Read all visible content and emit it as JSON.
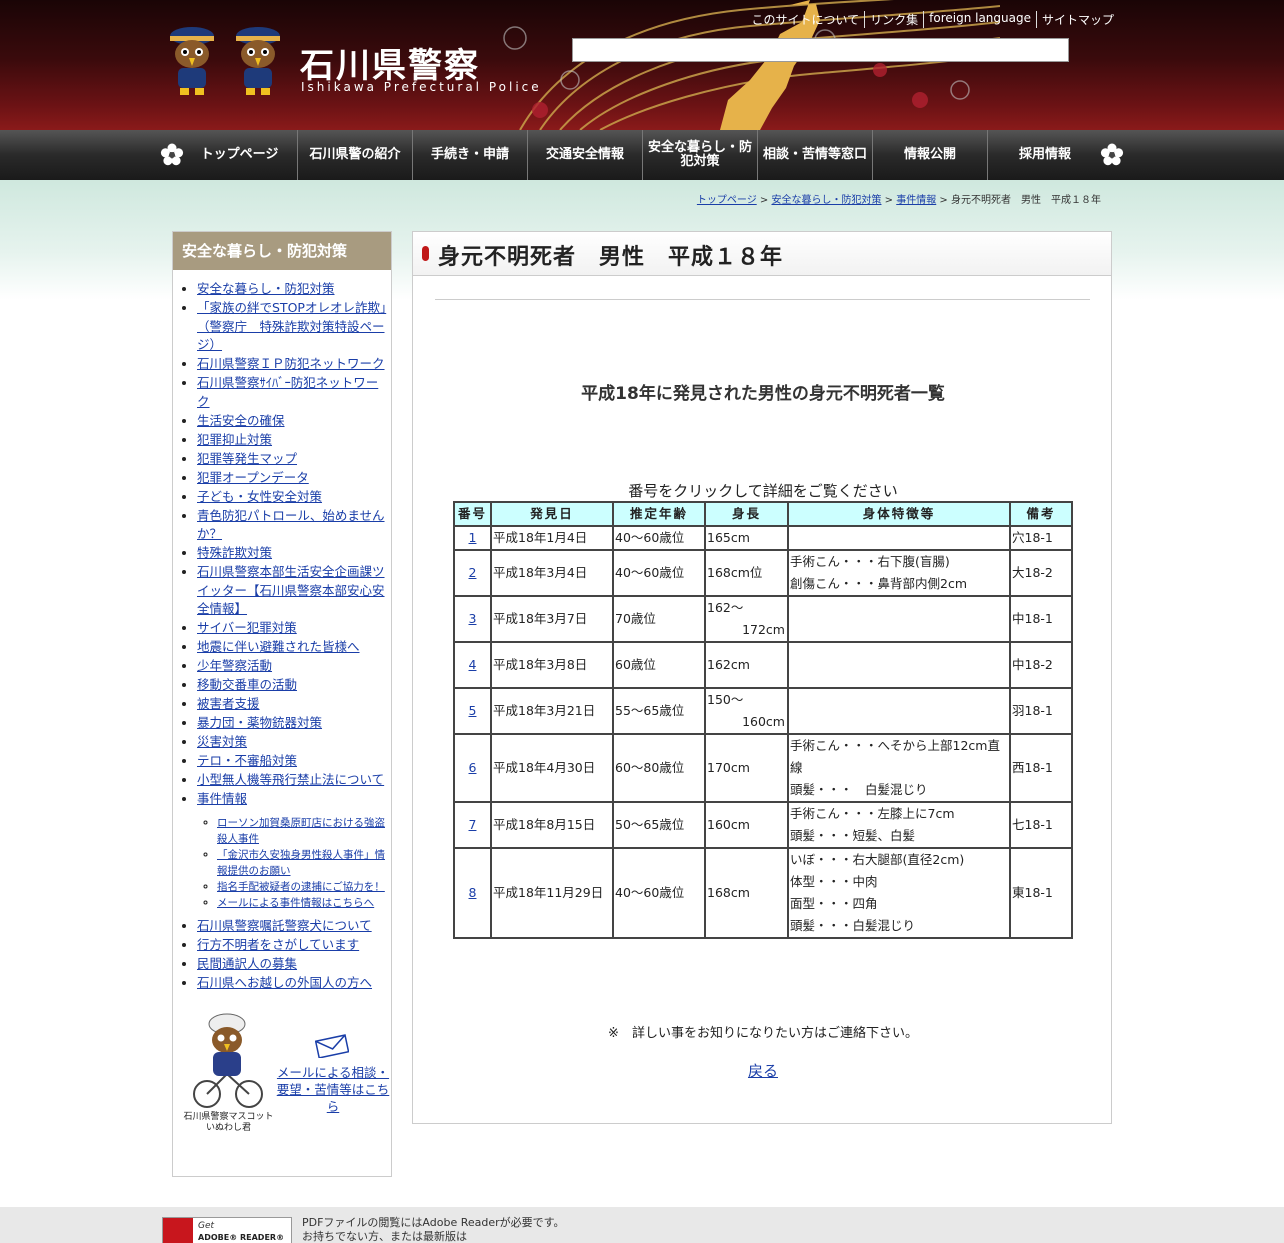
{
  "header": {
    "logo_title": "石川県警察",
    "logo_subtitle": "Ishikawa Prefectural Police",
    "search_placeholder": "",
    "util_links": [
      "このサイトについて",
      "リンク集",
      "foreign language",
      "サイトマップ"
    ]
  },
  "nav": {
    "items": [
      "トップページ",
      "石川県警の紹介",
      "手続き・申請",
      "交通安全情報",
      "安全な暮らし・防犯対策",
      "相談・苦情等窓口",
      "情報公開",
      "採用情報"
    ]
  },
  "breadcrumb": {
    "links": [
      "トップページ",
      "安全な暮らし・防犯対策",
      "事件情報"
    ],
    "separator": ">",
    "current": "身元不明死者　男性　平成１８年"
  },
  "sidebar": {
    "heading": "安全な暮らし・防犯対策",
    "items": [
      "安全な暮らし・防犯対策",
      "「家族の絆でSTOPオレオレ詐欺」（警察庁　特殊詐欺対策特設ページ）",
      "石川県警察ＩＰ防犯ネットワーク",
      "石川県警察ｻｲﾊﾞｰ防犯ネットワーク",
      "生活安全の確保",
      "犯罪抑止対策",
      "犯罪等発生マップ",
      "犯罪オープンデータ",
      "子ども・女性安全対策",
      "青色防犯パトロール、始めませんか？",
      "特殊詐欺対策",
      "石川県警察本部生活安全企画課ツイッター【石川県警察本部安心安全情報】",
      "サイバー犯罪対策",
      "地震に伴い避難された皆様へ",
      "少年警察活動",
      "移動交番車の活動",
      "被害者支援",
      "暴力団・薬物銃器対策",
      "災害対策",
      "テロ・不審船対策",
      "小型無人機等飛行禁止法について",
      "事件情報"
    ],
    "sub_items": [
      "ローソン加賀桑原町店における強盗殺人事件",
      "「金沢市久安独身男性殺人事件」情報提供のお願い",
      "指名手配被疑者の逮捕にご協力を！",
      "メールによる事件情報はこちらへ"
    ],
    "items_after": [
      "石川県警察嘱託警察犬について",
      "行方不明者をさがしています",
      "民間通訳人の募集",
      "石川県へお越しの外国人の方へ"
    ],
    "mascot_caption": [
      "石川県警察マスコット",
      "いぬわし君"
    ],
    "mail_link": "メールによる相談・要望・苦情等はこちら"
  },
  "main": {
    "title": "身元不明死者　男性　平成１８年",
    "section_heading": "平成18年に発見された男性の身元不明死者一覧",
    "table_caption": "番号をクリックして詳細をご覧ください",
    "note": "※　詳しい事をお知りになりたい方はご連絡下さい。",
    "back_link": "戻る"
  },
  "table": {
    "headers": [
      "番号",
      "発見日",
      "推定年齢",
      "身長",
      "身体特徴等",
      "備考"
    ],
    "rows": [
      {
        "no": "1",
        "date": "平成18年1月4日",
        "age": "40～60歳位",
        "height": [
          "165cm"
        ],
        "features": [],
        "note": "穴18-1"
      },
      {
        "no": "2",
        "date": "平成18年3月4日",
        "age": "40～60歳位",
        "height": [
          "168cm位"
        ],
        "features": [
          "手術こん・・・右下腹(盲腸)",
          "創傷こん・・・鼻背部内側2cm"
        ],
        "note": "大18-2"
      },
      {
        "no": "3",
        "date": "平成18年3月7日",
        "age": "70歳位",
        "height": [
          "162～",
          "172cm"
        ],
        "features": [],
        "note": "中18-1"
      },
      {
        "no": "4",
        "date": "平成18年3月8日",
        "age": "60歳位",
        "height": [
          "162cm"
        ],
        "features": [],
        "note": "中18-2"
      },
      {
        "no": "5",
        "date": "平成18年3月21日",
        "age": "55～65歳位",
        "height": [
          "150～",
          "160cm"
        ],
        "features": [],
        "note": "羽18-1"
      },
      {
        "no": "6",
        "date": "平成18年4月30日",
        "age": "60～80歳位",
        "height": [
          "170cm"
        ],
        "features": [
          "手術こん・・・へそから上部12cm直線",
          "頭髪・・・　白髪混じり"
        ],
        "note": "西18-1"
      },
      {
        "no": "7",
        "date": "平成18年8月15日",
        "age": "50～65歳位",
        "height": [
          "160cm"
        ],
        "features": [
          "手術こん・・・左膝上に7cm",
          "頭髪・・・短髪、白髪"
        ],
        "note": "七18-1"
      },
      {
        "no": "8",
        "date": "平成18年11月29日",
        "age": "40～60歳位",
        "height": [
          "168cm"
        ],
        "features": [
          "いぼ・・・右大腿部(直径2cm)",
          "体型・・・中肉",
          "面型・・・四角",
          "頭髪・・・白髪混じり"
        ],
        "note": "東18-1"
      }
    ]
  },
  "footer": {
    "adobe_get": "Get",
    "adobe_name": "ADOBE® READER®",
    "lines": [
      "PDFファイルの閲覧にはAdobe Readerが必要です。",
      "お持ちでない方、または最新版は"
    ]
  },
  "colors": {
    "header_dark": "#1a0506",
    "header_red": "#8a1a1a",
    "nav_bg": "#2a2a2a",
    "sidebar_head": "#a89b80",
    "table_header_bg": "#ccffff",
    "link": "#1a3ea8",
    "title_pill": "#c01818"
  }
}
